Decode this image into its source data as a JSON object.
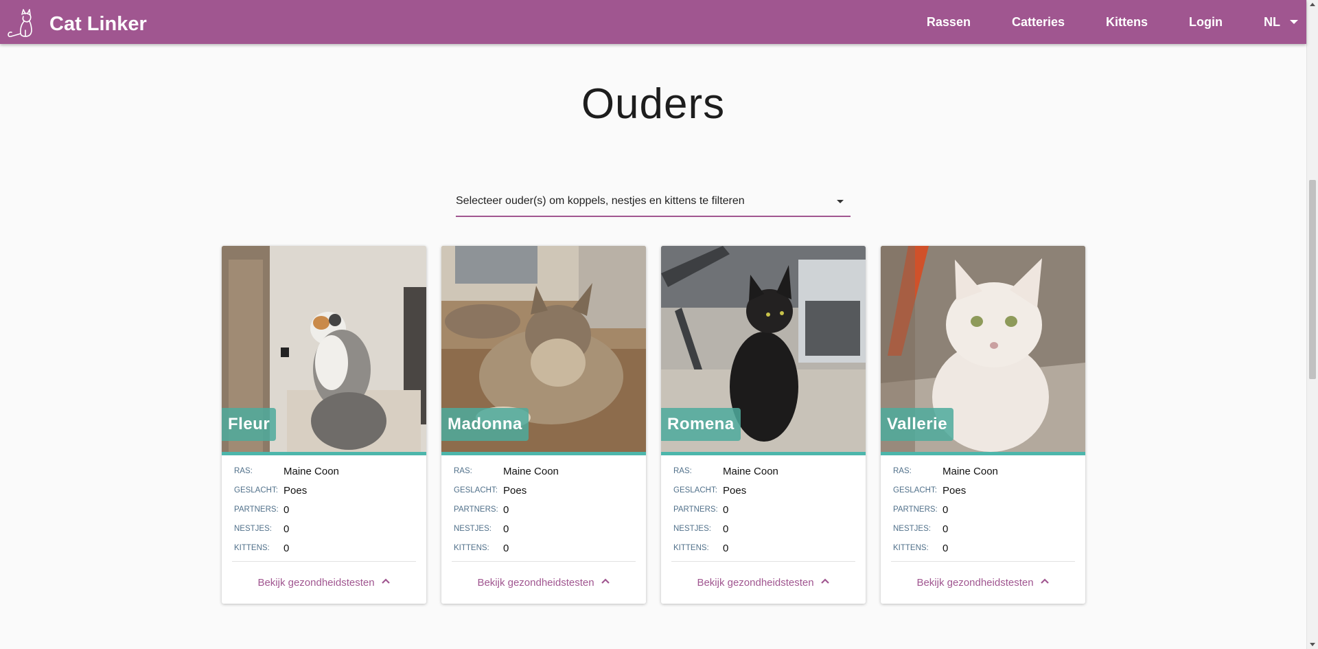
{
  "navbar": {
    "brand": "Cat Linker",
    "logo_icon": "cat-logo-icon",
    "items": [
      {
        "label": "Rassen"
      },
      {
        "label": "Catteries"
      },
      {
        "label": "Kittens"
      },
      {
        "label": "Login"
      }
    ],
    "language": "NL",
    "color": "#a05690"
  },
  "page": {
    "title": "Ouders",
    "filter_placeholder": "Selecteer ouder(s) om koppels, nestjes en kittens te filteren"
  },
  "labels": {
    "ras": "RAS:",
    "geslacht": "GESLACHT:",
    "partners": "PARTNERS:",
    "nestjes": "NESTJES:",
    "kittens": "KITTENS:",
    "health_link": "Bekijk gezondheidstesten",
    "health_icon": "chevron-up-icon"
  },
  "cats": [
    {
      "name": "Fleur",
      "ras": "Maine Coon",
      "geslacht": "Poes",
      "partners": "0",
      "nestjes": "0",
      "kittens": "0"
    },
    {
      "name": "Madonna",
      "ras": "Maine Coon",
      "geslacht": "Poes",
      "partners": "0",
      "nestjes": "0",
      "kittens": "0"
    },
    {
      "name": "Romena",
      "ras": "Maine Coon",
      "geslacht": "Poes",
      "partners": "0",
      "nestjes": "0",
      "kittens": "0"
    },
    {
      "name": "Vallerie",
      "ras": "Maine Coon",
      "geslacht": "Poes",
      "partners": "0",
      "nestjes": "0",
      "kittens": "0"
    }
  ],
  "colors": {
    "accent": "#a05690",
    "teal": "#4cb6ab"
  }
}
